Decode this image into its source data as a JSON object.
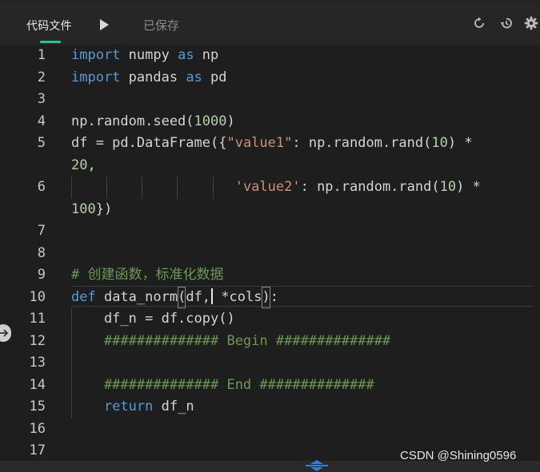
{
  "header": {
    "tab_label": "代码文件",
    "saved_status": "已保存",
    "icons": [
      "run-icon",
      "refresh-icon",
      "history-icon",
      "gear-icon"
    ]
  },
  "editor": {
    "lines": [
      {
        "n": "1"
      },
      {
        "n": "2"
      },
      {
        "n": "3"
      },
      {
        "n": "4"
      },
      {
        "n": "5"
      },
      {
        "n": ""
      },
      {
        "n": "6"
      },
      {
        "n": ""
      },
      {
        "n": "7"
      },
      {
        "n": "8"
      },
      {
        "n": "9"
      },
      {
        "n": "10"
      },
      {
        "n": "11"
      },
      {
        "n": "12"
      },
      {
        "n": "13"
      },
      {
        "n": "14"
      },
      {
        "n": "15"
      },
      {
        "n": "16"
      },
      {
        "n": "17"
      }
    ],
    "tokens": {
      "l1_kw": "import",
      "l1_a": " numpy ",
      "l1_kw2": "as",
      "l1_b": " np",
      "l2_kw": "import",
      "l2_a": " pandas ",
      "l2_kw2": "as",
      "l2_b": " pd",
      "l4_a": "np.random.seed(",
      "l4_num": "1000",
      "l4_b": ")",
      "l5_a": "df = pd.DataFrame({",
      "l5_str": "\"value1\"",
      "l5_b": ": np.random.rand(",
      "l5_num": "10",
      "l5_c": ") *",
      "l5w_num": "20",
      "l5w_b": ",",
      "l6_pad": "                    ",
      "l6_str": "'value2'",
      "l6_b": ": np.random.rand(",
      "l6_num": "10",
      "l6_c": ") *",
      "l6w_num": "100",
      "l6w_b": "})",
      "l9_cmt": "# 创建函数，标准化数据",
      "l10_kw": "def",
      "l10_a": " data_norm",
      "l10_paren": "(",
      "l10_b": "df,",
      "l10_c": " *cols",
      "l10_paren2": ")",
      "l10_d": ":",
      "l11_a": "    df_n = df.copy()",
      "l12_cmt": "    ############## Begin ##############",
      "l14_cmt": "    ############## End ##############",
      "l15_pad": "    ",
      "l15_kw": "return",
      "l15_a": " df_n"
    }
  },
  "watermark": "CSDN @Shining0596",
  "colors": {
    "keyword": "#569cd6",
    "number": "#b5cea8",
    "string": "#ce9178",
    "comment": "#6a9955",
    "accent": "#25c2a0"
  }
}
